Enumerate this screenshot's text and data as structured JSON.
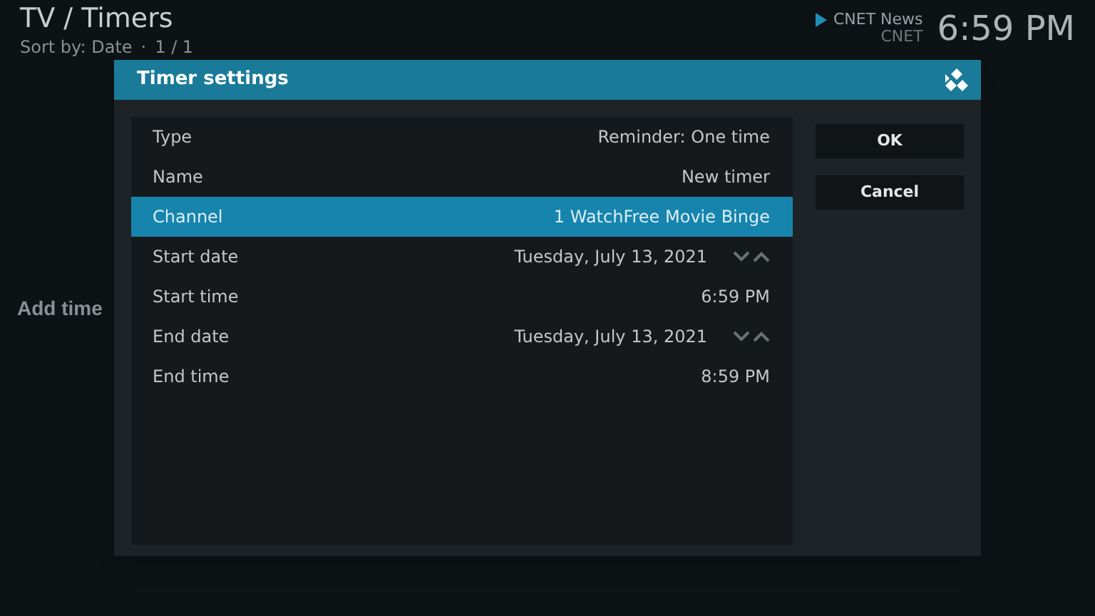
{
  "header": {
    "title": "TV / Timers",
    "sort": "Sort by: Date",
    "separator": "·",
    "count": "1 / 1"
  },
  "now_playing": {
    "channel": "CNET News",
    "subtitle": "CNET"
  },
  "clock": "6:59 PM",
  "background_item": "Add time",
  "dialog": {
    "title": "Timer settings",
    "rows": [
      {
        "label": "Type",
        "value": "Reminder: One time",
        "kind": "value",
        "selected": false
      },
      {
        "label": "Name",
        "value": "New timer",
        "kind": "value",
        "selected": false
      },
      {
        "label": "Channel",
        "value": "1 WatchFree Movie Binge",
        "kind": "value",
        "selected": true
      },
      {
        "label": "Start date",
        "value": "Tuesday, July 13, 2021",
        "kind": "spinner",
        "selected": false
      },
      {
        "label": "Start time",
        "value": "6:59 PM",
        "kind": "value",
        "selected": false
      },
      {
        "label": "End date",
        "value": "Tuesday, July 13, 2021",
        "kind": "spinner",
        "selected": false
      },
      {
        "label": "End time",
        "value": "8:59 PM",
        "kind": "value",
        "selected": false
      }
    ],
    "buttons": [
      "OK",
      "Cancel"
    ]
  }
}
